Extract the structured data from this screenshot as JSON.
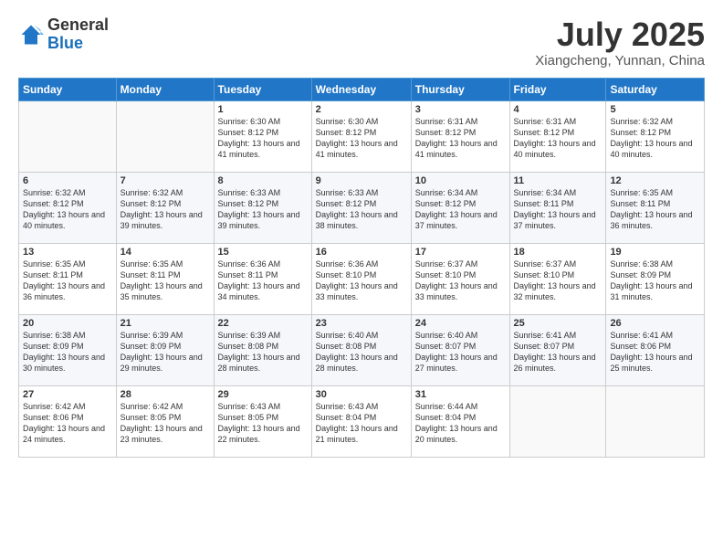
{
  "logo": {
    "general": "General",
    "blue": "Blue"
  },
  "header": {
    "month": "July 2025",
    "location": "Xiangcheng, Yunnan, China"
  },
  "days_of_week": [
    "Sunday",
    "Monday",
    "Tuesday",
    "Wednesday",
    "Thursday",
    "Friday",
    "Saturday"
  ],
  "weeks": [
    [
      {
        "day": "",
        "sunrise": "",
        "sunset": "",
        "daylight": ""
      },
      {
        "day": "",
        "sunrise": "",
        "sunset": "",
        "daylight": ""
      },
      {
        "day": "1",
        "sunrise": "Sunrise: 6:30 AM",
        "sunset": "Sunset: 8:12 PM",
        "daylight": "Daylight: 13 hours and 41 minutes."
      },
      {
        "day": "2",
        "sunrise": "Sunrise: 6:30 AM",
        "sunset": "Sunset: 8:12 PM",
        "daylight": "Daylight: 13 hours and 41 minutes."
      },
      {
        "day": "3",
        "sunrise": "Sunrise: 6:31 AM",
        "sunset": "Sunset: 8:12 PM",
        "daylight": "Daylight: 13 hours and 41 minutes."
      },
      {
        "day": "4",
        "sunrise": "Sunrise: 6:31 AM",
        "sunset": "Sunset: 8:12 PM",
        "daylight": "Daylight: 13 hours and 40 minutes."
      },
      {
        "day": "5",
        "sunrise": "Sunrise: 6:32 AM",
        "sunset": "Sunset: 8:12 PM",
        "daylight": "Daylight: 13 hours and 40 minutes."
      }
    ],
    [
      {
        "day": "6",
        "sunrise": "Sunrise: 6:32 AM",
        "sunset": "Sunset: 8:12 PM",
        "daylight": "Daylight: 13 hours and 40 minutes."
      },
      {
        "day": "7",
        "sunrise": "Sunrise: 6:32 AM",
        "sunset": "Sunset: 8:12 PM",
        "daylight": "Daylight: 13 hours and 39 minutes."
      },
      {
        "day": "8",
        "sunrise": "Sunrise: 6:33 AM",
        "sunset": "Sunset: 8:12 PM",
        "daylight": "Daylight: 13 hours and 39 minutes."
      },
      {
        "day": "9",
        "sunrise": "Sunrise: 6:33 AM",
        "sunset": "Sunset: 8:12 PM",
        "daylight": "Daylight: 13 hours and 38 minutes."
      },
      {
        "day": "10",
        "sunrise": "Sunrise: 6:34 AM",
        "sunset": "Sunset: 8:12 PM",
        "daylight": "Daylight: 13 hours and 37 minutes."
      },
      {
        "day": "11",
        "sunrise": "Sunrise: 6:34 AM",
        "sunset": "Sunset: 8:11 PM",
        "daylight": "Daylight: 13 hours and 37 minutes."
      },
      {
        "day": "12",
        "sunrise": "Sunrise: 6:35 AM",
        "sunset": "Sunset: 8:11 PM",
        "daylight": "Daylight: 13 hours and 36 minutes."
      }
    ],
    [
      {
        "day": "13",
        "sunrise": "Sunrise: 6:35 AM",
        "sunset": "Sunset: 8:11 PM",
        "daylight": "Daylight: 13 hours and 36 minutes."
      },
      {
        "day": "14",
        "sunrise": "Sunrise: 6:35 AM",
        "sunset": "Sunset: 8:11 PM",
        "daylight": "Daylight: 13 hours and 35 minutes."
      },
      {
        "day": "15",
        "sunrise": "Sunrise: 6:36 AM",
        "sunset": "Sunset: 8:11 PM",
        "daylight": "Daylight: 13 hours and 34 minutes."
      },
      {
        "day": "16",
        "sunrise": "Sunrise: 6:36 AM",
        "sunset": "Sunset: 8:10 PM",
        "daylight": "Daylight: 13 hours and 33 minutes."
      },
      {
        "day": "17",
        "sunrise": "Sunrise: 6:37 AM",
        "sunset": "Sunset: 8:10 PM",
        "daylight": "Daylight: 13 hours and 33 minutes."
      },
      {
        "day": "18",
        "sunrise": "Sunrise: 6:37 AM",
        "sunset": "Sunset: 8:10 PM",
        "daylight": "Daylight: 13 hours and 32 minutes."
      },
      {
        "day": "19",
        "sunrise": "Sunrise: 6:38 AM",
        "sunset": "Sunset: 8:09 PM",
        "daylight": "Daylight: 13 hours and 31 minutes."
      }
    ],
    [
      {
        "day": "20",
        "sunrise": "Sunrise: 6:38 AM",
        "sunset": "Sunset: 8:09 PM",
        "daylight": "Daylight: 13 hours and 30 minutes."
      },
      {
        "day": "21",
        "sunrise": "Sunrise: 6:39 AM",
        "sunset": "Sunset: 8:09 PM",
        "daylight": "Daylight: 13 hours and 29 minutes."
      },
      {
        "day": "22",
        "sunrise": "Sunrise: 6:39 AM",
        "sunset": "Sunset: 8:08 PM",
        "daylight": "Daylight: 13 hours and 28 minutes."
      },
      {
        "day": "23",
        "sunrise": "Sunrise: 6:40 AM",
        "sunset": "Sunset: 8:08 PM",
        "daylight": "Daylight: 13 hours and 28 minutes."
      },
      {
        "day": "24",
        "sunrise": "Sunrise: 6:40 AM",
        "sunset": "Sunset: 8:07 PM",
        "daylight": "Daylight: 13 hours and 27 minutes."
      },
      {
        "day": "25",
        "sunrise": "Sunrise: 6:41 AM",
        "sunset": "Sunset: 8:07 PM",
        "daylight": "Daylight: 13 hours and 26 minutes."
      },
      {
        "day": "26",
        "sunrise": "Sunrise: 6:41 AM",
        "sunset": "Sunset: 8:06 PM",
        "daylight": "Daylight: 13 hours and 25 minutes."
      }
    ],
    [
      {
        "day": "27",
        "sunrise": "Sunrise: 6:42 AM",
        "sunset": "Sunset: 8:06 PM",
        "daylight": "Daylight: 13 hours and 24 minutes."
      },
      {
        "day": "28",
        "sunrise": "Sunrise: 6:42 AM",
        "sunset": "Sunset: 8:05 PM",
        "daylight": "Daylight: 13 hours and 23 minutes."
      },
      {
        "day": "29",
        "sunrise": "Sunrise: 6:43 AM",
        "sunset": "Sunset: 8:05 PM",
        "daylight": "Daylight: 13 hours and 22 minutes."
      },
      {
        "day": "30",
        "sunrise": "Sunrise: 6:43 AM",
        "sunset": "Sunset: 8:04 PM",
        "daylight": "Daylight: 13 hours and 21 minutes."
      },
      {
        "day": "31",
        "sunrise": "Sunrise: 6:44 AM",
        "sunset": "Sunset: 8:04 PM",
        "daylight": "Daylight: 13 hours and 20 minutes."
      },
      {
        "day": "",
        "sunrise": "",
        "sunset": "",
        "daylight": ""
      },
      {
        "day": "",
        "sunrise": "",
        "sunset": "",
        "daylight": ""
      }
    ]
  ]
}
